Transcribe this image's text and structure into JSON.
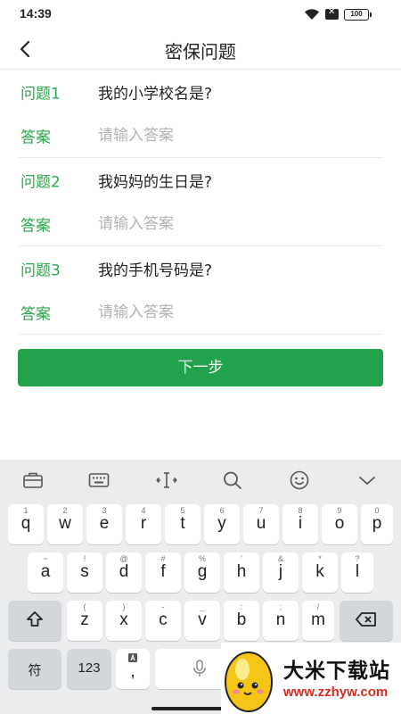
{
  "status_bar": {
    "time": "14:39",
    "battery": "100",
    "icons": [
      "wifi-icon",
      "sim-off-icon",
      "battery-icon"
    ]
  },
  "nav": {
    "title": "密保问题",
    "back_icon": "chevron-left-icon"
  },
  "questions": [
    {
      "label": "问题1",
      "question": "我的小学校名是?",
      "answer_label": "答案",
      "answer_value": "",
      "answer_placeholder": "请输入答案"
    },
    {
      "label": "问题2",
      "question": "我妈妈的生日是?",
      "answer_label": "答案",
      "answer_value": "",
      "answer_placeholder": "请输入答案"
    },
    {
      "label": "问题3",
      "question": "我的手机号码是?",
      "answer_label": "答案",
      "answer_value": "",
      "answer_placeholder": "请输入答案"
    }
  ],
  "next_button": "下一步",
  "keyboard": {
    "toolbar": [
      "briefcase-icon",
      "keyboard-icon",
      "cursor-move-icon",
      "search-icon",
      "emoji-icon",
      "chevron-down-icon"
    ],
    "row1": [
      {
        "main": "q",
        "sub": "1"
      },
      {
        "main": "w",
        "sub": "2"
      },
      {
        "main": "e",
        "sub": "3"
      },
      {
        "main": "r",
        "sub": "4"
      },
      {
        "main": "t",
        "sub": "5"
      },
      {
        "main": "y",
        "sub": "6"
      },
      {
        "main": "u",
        "sub": "7"
      },
      {
        "main": "i",
        "sub": "8"
      },
      {
        "main": "o",
        "sub": "9"
      },
      {
        "main": "p",
        "sub": "0"
      }
    ],
    "row2": [
      {
        "main": "a",
        "sub": "~"
      },
      {
        "main": "s",
        "sub": "!"
      },
      {
        "main": "d",
        "sub": "@"
      },
      {
        "main": "f",
        "sub": "#"
      },
      {
        "main": "g",
        "sub": "%"
      },
      {
        "main": "h",
        "sub": "'"
      },
      {
        "main": "j",
        "sub": "&"
      },
      {
        "main": "k",
        "sub": "*"
      },
      {
        "main": "l",
        "sub": "?"
      }
    ],
    "row3": [
      {
        "main": "z",
        "sub": "("
      },
      {
        "main": "x",
        "sub": ")"
      },
      {
        "main": "c",
        "sub": "-"
      },
      {
        "main": "v",
        "sub": "_"
      },
      {
        "main": "b",
        "sub": ":"
      },
      {
        "main": "n",
        "sub": ";"
      },
      {
        "main": "m",
        "sub": "/"
      }
    ],
    "shift_icon": "shift-icon",
    "backspace_icon": "backspace-icon",
    "symbols_key": "符",
    "numbers_key": "123",
    "comma_key": ",",
    "space_icon": "microphone-icon"
  },
  "watermark": {
    "title": "大米下载站",
    "url": "www.zzhyw.com"
  },
  "colors": {
    "accent": "#20a34b",
    "label_green": "#2aa84a",
    "placeholder": "#b3b3b3"
  }
}
